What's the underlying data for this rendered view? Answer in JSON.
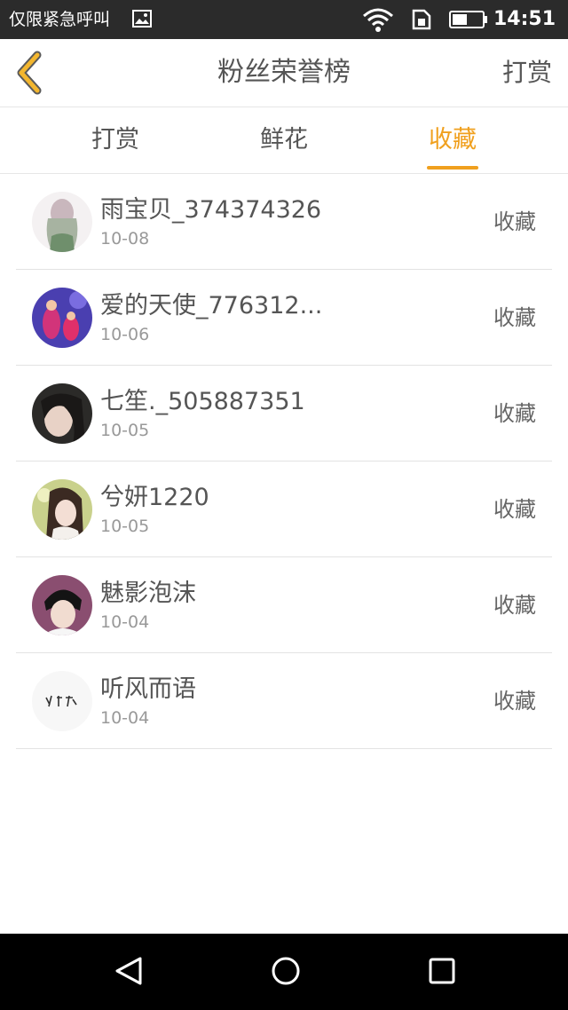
{
  "status_bar": {
    "emergency_text": "仅限紧急呼叫",
    "time": "14:51"
  },
  "header": {
    "title": "粉丝荣誉榜",
    "reward_link": "打赏"
  },
  "tabs": [
    {
      "label": "打赏",
      "active": false
    },
    {
      "label": "鲜花",
      "active": false
    },
    {
      "label": "收藏",
      "active": true
    }
  ],
  "accent_color": "#f0a01e",
  "fans": [
    {
      "name": "雨宝贝_374374326",
      "date": "10-08",
      "action": "收藏"
    },
    {
      "name": "爱的天使_776312...",
      "date": "10-06",
      "action": "收藏"
    },
    {
      "name": "七笙._505887351",
      "date": "10-05",
      "action": "收藏"
    },
    {
      "name": "兮妍1220",
      "date": "10-05",
      "action": "收藏"
    },
    {
      "name": "魅影泡沫",
      "date": "10-04",
      "action": "收藏"
    },
    {
      "name": "听风而语",
      "date": "10-04",
      "action": "收藏"
    }
  ],
  "icons": {
    "back": "chevron-left-icon",
    "gallery": "gallery-icon",
    "wifi": "wifi-icon",
    "sim": "sim-card-icon",
    "battery": "battery-icon",
    "nav_back": "triangle-back-icon",
    "nav_home": "circle-home-icon",
    "nav_recent": "square-recent-icon"
  }
}
